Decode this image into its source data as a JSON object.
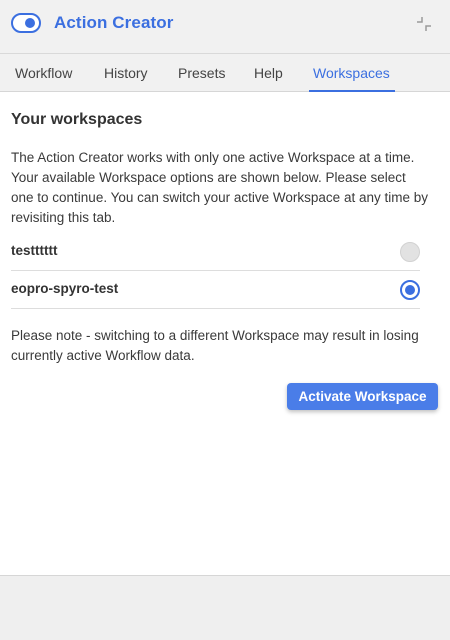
{
  "header": {
    "title": "Action Creator",
    "toggle_on": true,
    "toggle_icon": "toggle-switch-icon",
    "collapse_icon": "collapse-icon",
    "accent_color": "#3b6fe0"
  },
  "tabs": [
    {
      "label": "Workflow",
      "active": false
    },
    {
      "label": "History",
      "active": false
    },
    {
      "label": "Presets",
      "active": false
    },
    {
      "label": "Help",
      "active": false
    },
    {
      "label": "Workspaces",
      "active": true
    }
  ],
  "workspaces": {
    "title": "Your workspaces",
    "intro": "The Action Creator works with only one active Workspace at a time. Your available Workspace options are shown below. Please select one to continue. You can switch your active Workspace at any time by revisiting this tab.",
    "items": [
      {
        "name": "testttttt",
        "selected": false
      },
      {
        "name": "eopro-spyro-test",
        "selected": true
      }
    ],
    "note": "Please note - switching to a different Workspace may result in losing currently active Workflow data.",
    "activate_label": "Activate Workspace"
  }
}
